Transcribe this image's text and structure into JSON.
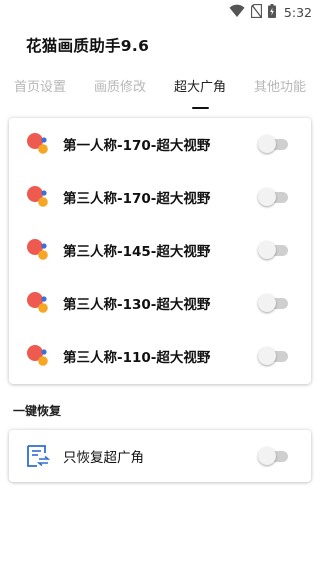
{
  "status_bar": {
    "time": "5:32",
    "icons": [
      "wifi-icon",
      "no-sim-icon",
      "battery-charging-icon"
    ]
  },
  "app": {
    "title": "花猫画质助手9.6"
  },
  "tabs": [
    {
      "label": "首页设置",
      "active": false
    },
    {
      "label": "画质修改",
      "active": false
    },
    {
      "label": "超大广角",
      "active": true
    },
    {
      "label": "其他功能",
      "active": false
    }
  ],
  "main_card": {
    "rows": [
      {
        "label": "第一人称-170-超大视野",
        "enabled": false,
        "icon": "bubbles-icon"
      },
      {
        "label": "第三人称-170-超大视野",
        "enabled": false,
        "icon": "bubbles-icon"
      },
      {
        "label": "第三人称-145-超大视野",
        "enabled": false,
        "icon": "bubbles-icon"
      },
      {
        "label": "第三人称-130-超大视野",
        "enabled": false,
        "icon": "bubbles-icon"
      },
      {
        "label": "第三人称-110-超大视野",
        "enabled": false,
        "icon": "bubbles-icon"
      }
    ]
  },
  "restore_section": {
    "header": "一键恢复",
    "row": {
      "label": "只恢复超广角",
      "enabled": false,
      "icon": "restore-doc-icon"
    }
  },
  "colors": {
    "bubble_red": "#ee5a4f",
    "bubble_orange": "#f5a623",
    "bubble_blue": "#3d6fd8",
    "restore_icon_blue": "#2e6fd1",
    "tab_inactive": "#b7b7b7"
  }
}
